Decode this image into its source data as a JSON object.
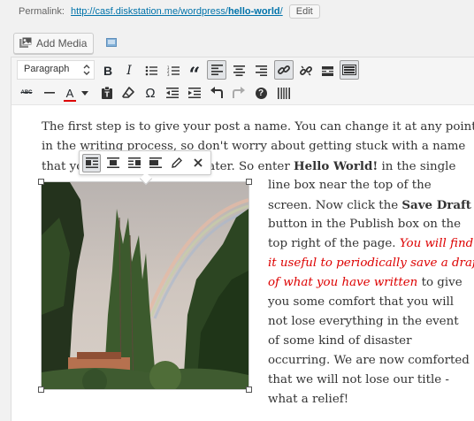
{
  "permalink": {
    "label": "Permalink:",
    "url_base": "http://casf.diskstation.me/wordpress/",
    "url_slug": "hello-world",
    "url_tail": "/",
    "edit_label": "Edit"
  },
  "media": {
    "add_media_label": "Add Media"
  },
  "toolbar": {
    "format_select_value": "Paragraph",
    "row1_buttons": [
      "bold-icon",
      "italic-icon",
      "bulleted-list-icon",
      "numbered-list-icon",
      "blockquote-icon",
      "align-left-icon",
      "align-center-icon",
      "align-right-icon",
      "insert-link-icon",
      "remove-link-icon",
      "read-more-icon",
      "toolbar-toggle-icon"
    ],
    "row2_buttons": [
      "strikethrough-icon",
      "horizontal-line-icon",
      "text-color-icon",
      "paste-as-text-icon",
      "clear-formatting-icon",
      "special-character-icon",
      "decrease-indent-icon",
      "increase-indent-icon",
      "undo-icon",
      "redo-icon",
      "keyboard-shortcuts-icon",
      "distraction-free-icon"
    ],
    "bold_glyph": "B",
    "italic_glyph": "I",
    "quote_glyph": "“",
    "strike_glyph": "ABC",
    "color_glyph": "A",
    "omega_glyph": "Ω",
    "help_glyph": "?"
  },
  "image_toolbar": {
    "buttons": [
      "align-left-icon",
      "align-center-icon",
      "align-right-icon",
      "no-align-icon",
      "edit-pencil-icon",
      "remove-x-icon"
    ]
  },
  "content": {
    "line1": "The first step is to give your post a name.  You can change it at any point",
    "line2": "in the writing process, so don't worry about getting stuck with a name",
    "line3_start": "that yo",
    "line3_mid": "ater.  So enter ",
    "line3_bold": "Hello World!",
    "line3_end": " in the single",
    "wrap_lines": [
      {
        "text": "line box near the top of the"
      },
      {
        "text": "screen.  Now click the ",
        "bold": "Save Draft"
      },
      {
        "text": "button in the Publish box on the"
      },
      {
        "text": "top right of the page.  ",
        "red": "You will find"
      },
      {
        "red": "it useful to periodically save a draft"
      },
      {
        "red": "of what you have written",
        "text_after": " to give"
      },
      {
        "text": "you some comfort that you will"
      },
      {
        "text": "not lose everything in the event"
      },
      {
        "text": "of some kind of disaster"
      },
      {
        "text": "occurring.  We are now comforted"
      },
      {
        "text": "that we will not lose our title -"
      },
      {
        "text": "what a relief!"
      }
    ]
  },
  "colors": {
    "link": "#0073aa",
    "red_text": "#dd0000",
    "text_color_underline": "#dd0000"
  }
}
